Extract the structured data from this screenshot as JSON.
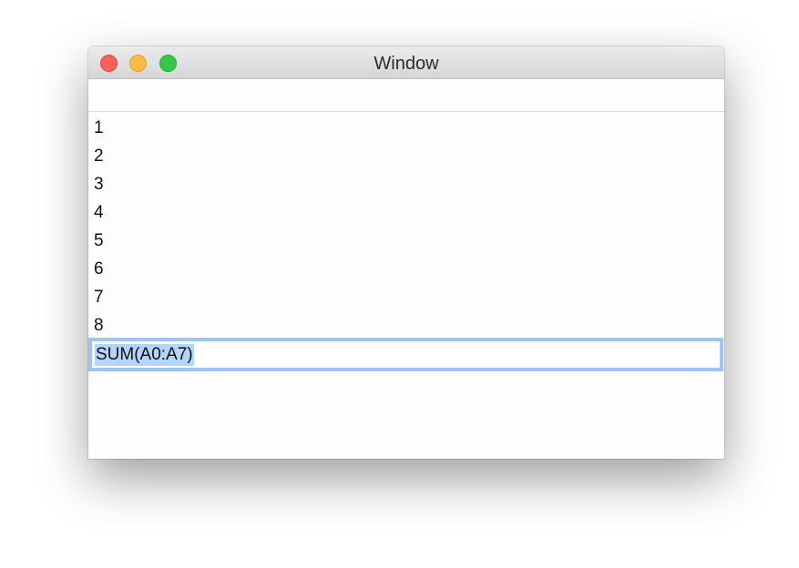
{
  "window": {
    "title": "Window"
  },
  "cells": [
    "1",
    "2",
    "3",
    "4",
    "5",
    "6",
    "7",
    "8"
  ],
  "editing_cell": {
    "value": "SUM(A0:A7)"
  },
  "colors": {
    "selection_border": "#9cc5f5",
    "selection_highlight": "#b3d5fc",
    "close": "#fc605c",
    "minimize": "#fdbc40",
    "maximize": "#34c84a"
  }
}
